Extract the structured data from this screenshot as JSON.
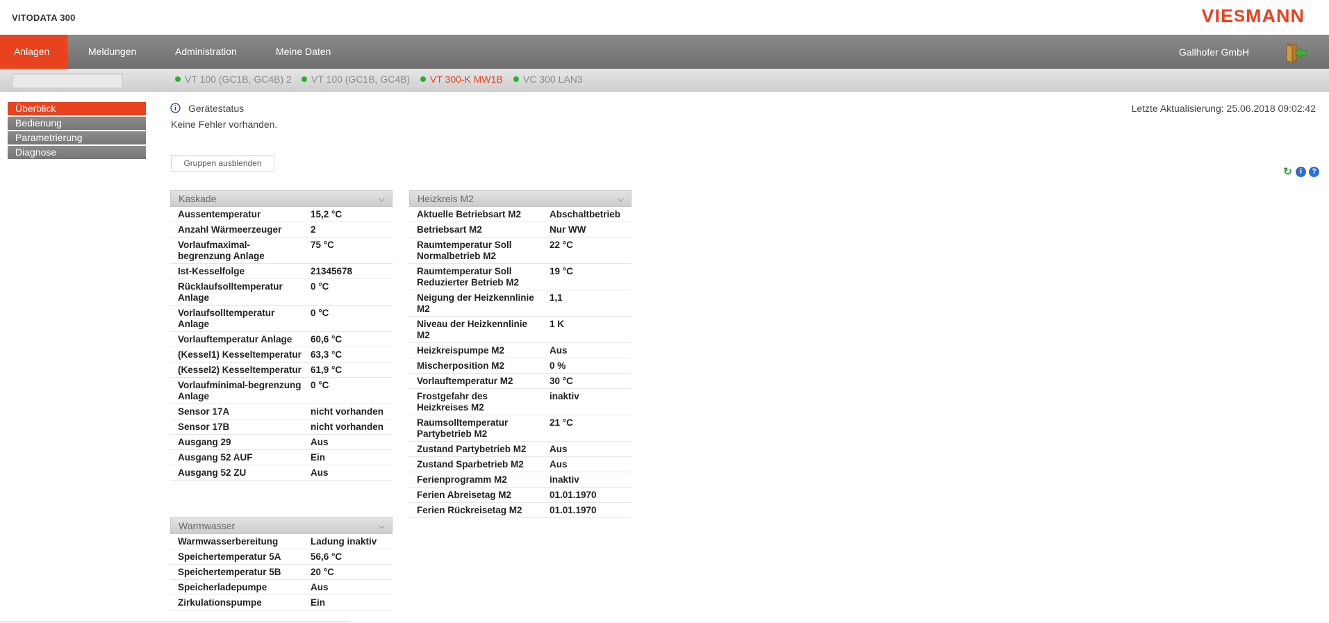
{
  "header": {
    "app_title": "VITODATA 300",
    "logo_text_left": "VIE",
    "logo_text_mid": "S",
    "logo_text_right": "MANN"
  },
  "mainnav": {
    "items": [
      {
        "label": "Anlagen",
        "active": true
      },
      {
        "label": "Meldungen"
      },
      {
        "label": "Administration"
      },
      {
        "label": "Meine Daten"
      }
    ],
    "company": "Gallhofer GmbH",
    "logout_icon": "logout-door-icon"
  },
  "devices": {
    "search_value": "",
    "tabs": [
      {
        "label": "VT 100 (GC1B, GC4B) 2",
        "status": "online"
      },
      {
        "label": "VT 100 (GC1B, GC4B)",
        "status": "online"
      },
      {
        "label": "VT 300-K MW1B",
        "status": "online",
        "active": true
      },
      {
        "label": "VC 300 LAN3",
        "status": "online"
      }
    ],
    "status_color": "#25b42c",
    "accent_color": "#e8421f"
  },
  "sidemenu": {
    "items": [
      {
        "label": "Überblick",
        "active": true
      },
      {
        "label": "Bedienung"
      },
      {
        "label": "Parametrierung"
      },
      {
        "label": "Diagnose"
      }
    ]
  },
  "status": {
    "title": "Gerätestatus",
    "text": "Keine Fehler vorhanden.",
    "last_update": "Letzte Aktualisierung: 25.06.2018 09:02:42"
  },
  "toolbar": {
    "hide_groups_label": "Gruppen ausblenden",
    "icons": [
      "refresh-icon",
      "info-icon",
      "help-icon"
    ]
  },
  "panels": {
    "kaskade": {
      "title": "Kaskade",
      "rows": [
        {
          "k": "Aussentemperatur",
          "v": "15,2 °C"
        },
        {
          "k": "Anzahl Wärmeerzeuger",
          "v": "2"
        },
        {
          "k": "Vorlaufmaximal-begrenzung Anlage",
          "v": "75 °C"
        },
        {
          "k": "Ist-Kesselfolge",
          "v": "21345678"
        },
        {
          "k": "Rücklaufsolltemperatur Anlage",
          "v": "0 °C"
        },
        {
          "k": "Vorlaufsolltemperatur Anlage",
          "v": "0 °C"
        },
        {
          "k": "Vorlauftemperatur Anlage",
          "v": "60,6 °C"
        },
        {
          "k": "(Kessel1) Kesseltemperatur",
          "v": "63,3 °C"
        },
        {
          "k": "(Kessel2) Kesseltemperatur",
          "v": "61,9 °C"
        },
        {
          "k": "Vorlaufminimal-begrenzung Anlage",
          "v": "0 °C"
        },
        {
          "k": "Sensor 17A",
          "v": "nicht vorhanden"
        },
        {
          "k": "Sensor 17B",
          "v": "nicht vorhanden"
        },
        {
          "k": "Ausgang 29",
          "v": "Aus"
        },
        {
          "k": "Ausgang 52 AUF",
          "v": "Ein"
        },
        {
          "k": "Ausgang 52 ZU",
          "v": "Aus"
        }
      ]
    },
    "heizkreis": {
      "title": "Heizkreis M2",
      "rows": [
        {
          "k": "Aktuelle Betriebsart M2",
          "v": "Abschaltbetrieb"
        },
        {
          "k": "Betriebsart M2",
          "v": "Nur WW"
        },
        {
          "k": "Raumtemperatur Soll Normalbetrieb M2",
          "v": "22 °C"
        },
        {
          "k": "Raumtemperatur Soll Reduzierter Betrieb M2",
          "v": "19 °C"
        },
        {
          "k": "Neigung der Heizkennlinie M2",
          "v": "1,1"
        },
        {
          "k": "Niveau der Heizkennlinie M2",
          "v": "1 K"
        },
        {
          "k": "Heizkreispumpe M2",
          "v": "Aus"
        },
        {
          "k": "Mischerposition M2",
          "v": "0 %"
        },
        {
          "k": "Vorlauftemperatur M2",
          "v": "30 °C"
        },
        {
          "k": "Frostgefahr des Heizkreises M2",
          "v": "inaktiv"
        },
        {
          "k": "Raumsolltemperatur Partybetrieb M2",
          "v": "21 °C"
        },
        {
          "k": "Zustand Partybetrieb M2",
          "v": "Aus"
        },
        {
          "k": "Zustand Sparbetrieb M2",
          "v": "Aus"
        },
        {
          "k": "Ferienprogramm M2",
          "v": "inaktiv"
        },
        {
          "k": "Ferien Abreisetag M2",
          "v": "01.01.1970"
        },
        {
          "k": "Ferien Rückreisetag M2",
          "v": "01.01.1970"
        }
      ]
    },
    "warmwasser": {
      "title": "Warmwasser",
      "rows": [
        {
          "k": "Warmwasserbereitung",
          "v": "Ladung inaktiv"
        },
        {
          "k": "Speichertemperatur 5A",
          "v": "56,6 °C"
        },
        {
          "k": "Speichertemperatur 5B",
          "v": "20 °C"
        },
        {
          "k": "Speicherladepumpe",
          "v": "Aus"
        },
        {
          "k": "Zirkulationspumpe",
          "v": "Ein"
        }
      ]
    }
  }
}
